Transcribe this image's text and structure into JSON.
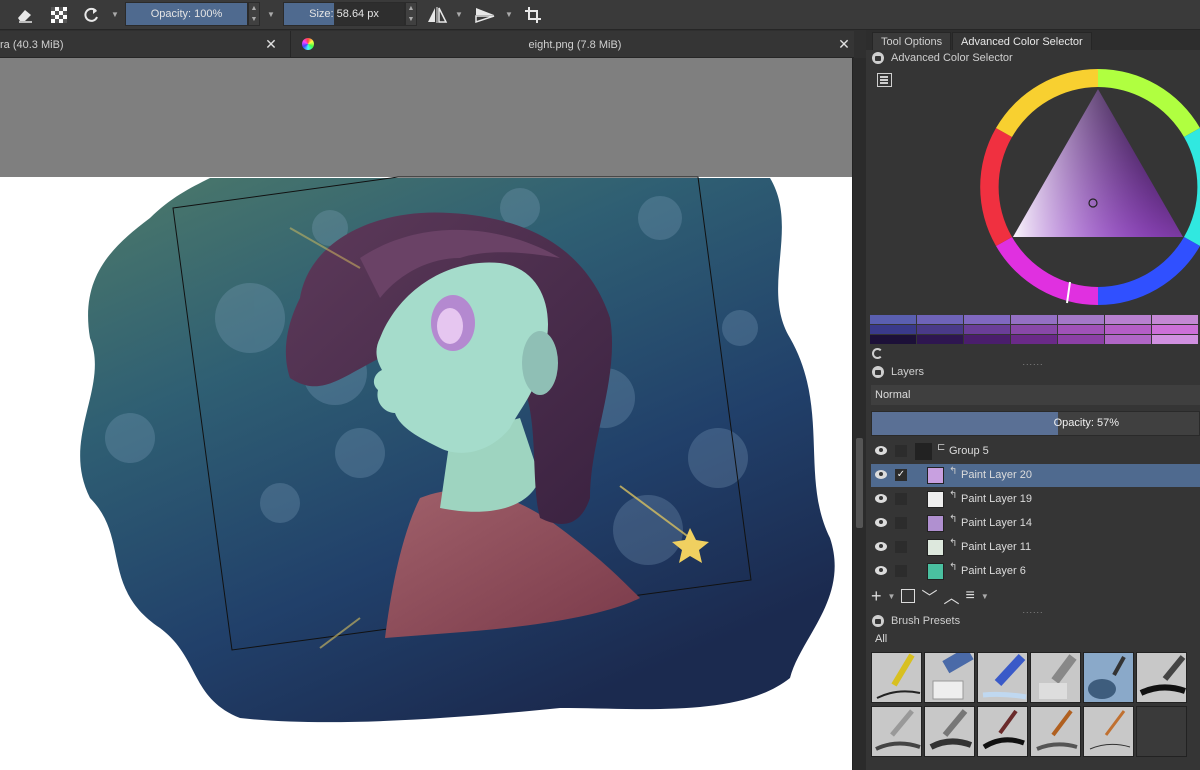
{
  "toolbar": {
    "opacity_label": "Opacity: 100%",
    "size_label": "Size: 58.64 px",
    "icons": [
      "eraser-icon",
      "alpha-lock-icon",
      "reload-icon",
      "mirror-horizontal-icon",
      "mirror-vertical-icon",
      "crop-icon"
    ]
  },
  "documents": {
    "tab1": "ra (40.3 MiB)",
    "tab2": "eight.png (7.8 MiB)"
  },
  "dock": {
    "tabs": [
      "Tool Options",
      "Advanced Color Selector"
    ],
    "color_selector_title": "Advanced Color Selector",
    "swatches_row1": [
      "#5a5fb0",
      "#6e63b8",
      "#8068c0",
      "#9470c4",
      "#a478c8",
      "#b880d0",
      "#c488d4"
    ],
    "swatches_row2": [
      "#3a3a8a",
      "#4a3a88",
      "#6a3e98",
      "#8848a8",
      "#a052b8",
      "#b45ec6",
      "#cc70d8"
    ],
    "swatches_row3": [
      "#1c1038",
      "#2e1650",
      "#4a1e6c",
      "#6a2a88",
      "#8c40a6",
      "#b066c6",
      "#d090e0"
    ],
    "layers_title": "Layers",
    "blend_mode": "Normal",
    "opacity_label": "Opacity:  57%",
    "opacity_value": 57,
    "layers": [
      {
        "name": "Group 5",
        "checked": false,
        "selected": false
      },
      {
        "name": "Paint Layer 20",
        "checked": true,
        "selected": true
      },
      {
        "name": "Paint Layer 19",
        "checked": false,
        "selected": false
      },
      {
        "name": "Paint Layer 14",
        "checked": false,
        "selected": false
      },
      {
        "name": "Paint Layer 11",
        "checked": false,
        "selected": false
      },
      {
        "name": "Paint Layer 6",
        "checked": false,
        "selected": false
      }
    ],
    "brush_presets_title": "Brush Presets",
    "brush_filter": "All"
  }
}
